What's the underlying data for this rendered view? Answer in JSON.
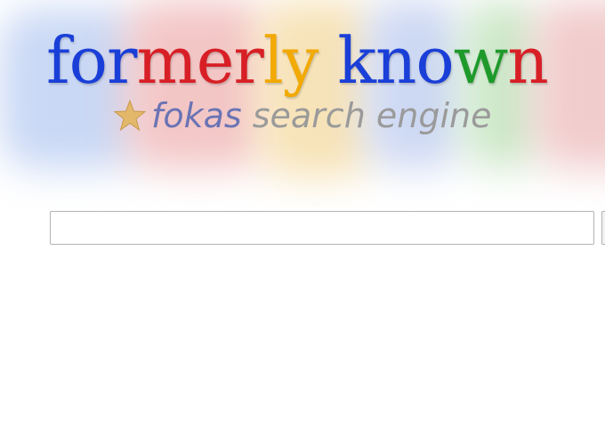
{
  "banner": {
    "logo_segments": [
      {
        "text": "f",
        "color": "#1a3fd8"
      },
      {
        "text": "o",
        "color": "#1a3fd8"
      },
      {
        "text": "r",
        "color": "#1a3fd8"
      },
      {
        "text": "m",
        "color": "#d81f26"
      },
      {
        "text": "e",
        "color": "#d81f26"
      },
      {
        "text": "r",
        "color": "#d81f26"
      },
      {
        "text": "l",
        "color": "#f2a900"
      },
      {
        "text": "y",
        "color": "#f2a900"
      },
      {
        "text": " ",
        "color": "#000000"
      },
      {
        "text": "k",
        "color": "#1a3fd8"
      },
      {
        "text": "n",
        "color": "#1a3fd8"
      },
      {
        "text": "o",
        "color": "#1a3fd8"
      },
      {
        "text": "w",
        "color": "#1e9a2a"
      },
      {
        "text": "n",
        "color": "#d81f26"
      }
    ],
    "logo_text": "formerly known",
    "sub_brand": "fokas",
    "sub_rest": "search engine",
    "star_color": "#e4b86a"
  },
  "search": {
    "value": "",
    "placeholder": "",
    "button_label": ""
  }
}
